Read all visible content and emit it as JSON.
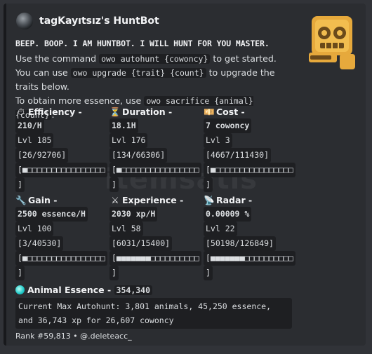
{
  "author": {
    "name": "tagKayıtsız's HuntBot"
  },
  "headline": "BEEP. BOOP. I AM HUNTBOT. I WILL HUNT FOR YOU MASTER.",
  "description": {
    "line1_pre": "Use the command ",
    "line1_cmd": "owo autohunt {cowoncy}",
    "line1_post": " to get started.",
    "line2_pre": "You can use ",
    "line2_cmd": "owo upgrade {trait} {count}",
    "line2_post": " to upgrade the traits below.",
    "line3_pre": "To obtain more essence, use ",
    "line3_cmd": "owo sacrifice {animal} {count}",
    "line3_post": "."
  },
  "traits": [
    {
      "icon": "stopwatch-icon",
      "glyph": "⏱",
      "name": "Efficiency",
      "value": "210/H",
      "level": "Lvl 185",
      "progress": "[26/92706]",
      "bar": "[■□□□□□□□□□□□□□□□□",
      "bar_end": "]",
      "progress_fraction": 0.0003
    },
    {
      "icon": "hourglass-icon",
      "glyph": "⏳",
      "name": "Duration",
      "value": "18.1H",
      "level": "Lvl 176",
      "progress": "[134/66306]",
      "bar": "[■□□□□□□□□□□□□□□□□",
      "bar_end": "]",
      "progress_fraction": 0.002
    },
    {
      "icon": "cash-icon",
      "glyph": "💴",
      "name": "Cost",
      "value": "7 cowoncy",
      "level": "Lvl 3",
      "progress": "[4667/111430]",
      "bar": "[■□□□□□□□□□□□□□□□□",
      "bar_end": "]",
      "progress_fraction": 0.042
    },
    {
      "icon": "wrench-icon",
      "glyph": "🔧",
      "name": "Gain",
      "value": "2500 essence/H",
      "level": "Lvl 100",
      "progress": "[3/40530]",
      "bar": "[■□□□□□□□□□□□□□□□□",
      "bar_end": "]",
      "progress_fraction": 0.0001
    },
    {
      "icon": "crossed-swords-icon",
      "glyph": "⚔",
      "name": "Experience",
      "value": "2030 xp/H",
      "level": "Lvl 58",
      "progress": "[6031/15400]",
      "bar": "[■■■■■■■□□□□□□□□□□",
      "bar_end": "]",
      "progress_fraction": 0.39
    },
    {
      "icon": "satellite-icon",
      "glyph": "📡",
      "name": "Radar",
      "value": "0.00009 %",
      "level": "Lvl 22",
      "progress": "[50198/126849]",
      "bar": "[■■■■■■■□□□□□□□□□□",
      "bar_end": "]",
      "progress_fraction": 0.4
    }
  ],
  "essence": {
    "label": "Animal Essence",
    "value": "354,340"
  },
  "autohunt": {
    "line1": "Current Max Autohunt: 3,801 animals, 45,250 essence,",
    "line2": "and 36,743 xp for 26,607 cowoncy"
  },
  "footer": "Rank #59,813 • @.deleteacc_",
  "watermark": "itemsatis"
}
